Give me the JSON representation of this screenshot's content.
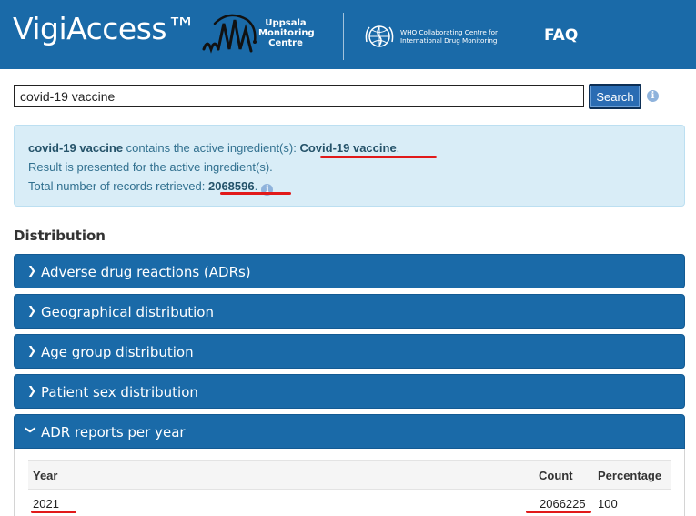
{
  "header": {
    "brand": "VigiAccess™",
    "umc_text": "Uppsala Monitoring Centre",
    "who_text": "WHO Collaborating Centre for International Drug Monitoring",
    "faq_label": "FAQ"
  },
  "search": {
    "value": "covid-19 vaccine",
    "button_label": "Search"
  },
  "result": {
    "query": "covid-19 vaccine",
    "line1_mid": " contains the active ingredient(s): ",
    "ingredient": "Covid-19 vaccine",
    "line1_end": ".",
    "line2": "Result is presented for the active ingredient(s).",
    "line3_prefix": "Total number of records retrieved: ",
    "total": "2068596",
    "line3_end": "."
  },
  "distribution": {
    "title": "Distribution",
    "panels": [
      {
        "label": "Adverse drug reactions (ADRs)",
        "expanded": false
      },
      {
        "label": "Geographical distribution",
        "expanded": false
      },
      {
        "label": "Age group distribution",
        "expanded": false
      },
      {
        "label": "Patient sex distribution",
        "expanded": false
      },
      {
        "label": "ADR reports per year",
        "expanded": true
      }
    ]
  },
  "adr_table": {
    "headers": [
      "Year",
      "Count",
      "Percentage"
    ],
    "rows": [
      {
        "year": "2021",
        "count": "2066225",
        "percentage": "100"
      }
    ]
  },
  "colors": {
    "header_bg": "#1a6aa8",
    "info_bg": "#d9edf7",
    "info_text": "#31708f",
    "highlight_underline": "#e11a1a"
  }
}
